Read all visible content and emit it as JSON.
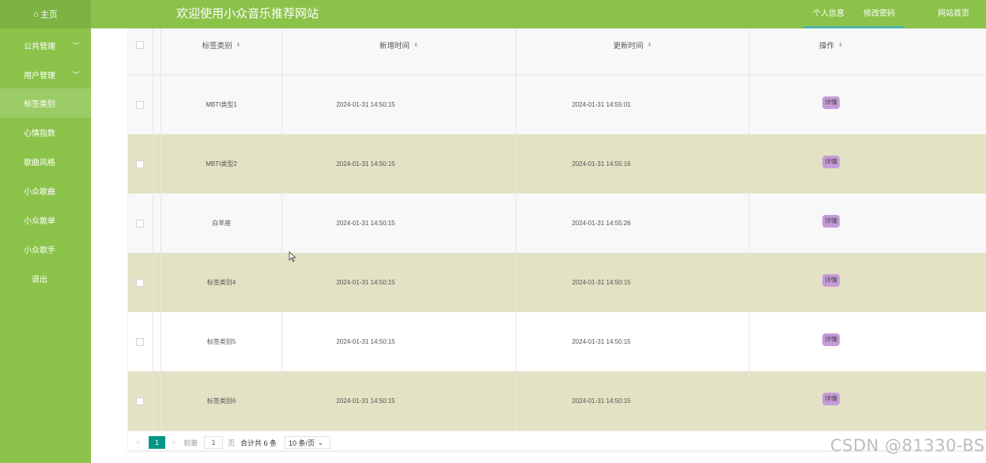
{
  "header": {
    "home_icon": "home-icon",
    "home_label": "主页",
    "site_title": "欢迎使用小众音乐推荐网站",
    "links": [
      "个人信息",
      "修改密码",
      "网站首页"
    ]
  },
  "sidebar": {
    "items": [
      {
        "label": "公共管理",
        "has_submenu": true
      },
      {
        "label": "用户管理",
        "has_submenu": true
      },
      {
        "label": "标签类别",
        "active": true
      },
      {
        "label": "心情指数"
      },
      {
        "label": "歌曲风格"
      },
      {
        "label": "小众歌曲"
      },
      {
        "label": "小众歌单"
      },
      {
        "label": "小众歌手"
      },
      {
        "label": "退出"
      }
    ]
  },
  "table": {
    "columns": [
      "标签类别",
      "新增时间",
      "更新时间",
      "操作"
    ],
    "rows": [
      {
        "category": "MBTI类型1",
        "created": "2024-01-31 14:50:15",
        "updated": "2024-01-31 14:55:01",
        "action": "详情"
      },
      {
        "category": "MBTI类型2",
        "created": "2024-01-31 14:50:15",
        "updated": "2024-01-31 14:55:16",
        "action": "详情"
      },
      {
        "category": "白羊座",
        "created": "2024-01-31 14:50:15",
        "updated": "2024-01-31 14:55:26",
        "action": "详情"
      },
      {
        "category": "标签类别4",
        "created": "2024-01-31 14:50:15",
        "updated": "2024-01-31 14:50:15",
        "action": "详情"
      },
      {
        "category": "标签类别5",
        "created": "2024-01-31 14:50:15",
        "updated": "2024-01-31 14:50:15",
        "action": "详情"
      },
      {
        "category": "标签类别6",
        "created": "2024-01-31 14:50:15",
        "updated": "2024-01-31 14:50:15",
        "action": "详情"
      }
    ]
  },
  "pagination": {
    "prev": "<",
    "current": "1",
    "next": ">",
    "goto_label": "到第",
    "goto_value": "1",
    "page_unit": "页",
    "total": "合计共 6 条",
    "page_size": "10 条/页"
  },
  "watermark": "CSDN @81330-BS",
  "colors": {
    "header_green": "#8bc34a",
    "row_alt": "#e3e2c4",
    "detail_button": "#c69bd9",
    "pager_active": "#009688"
  }
}
